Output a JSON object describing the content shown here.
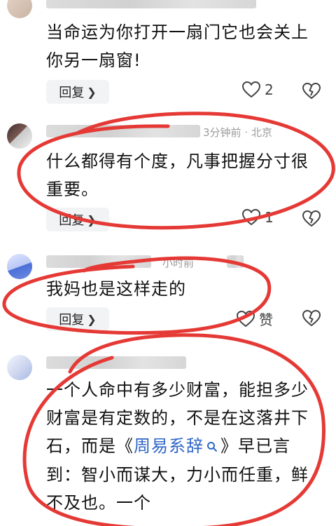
{
  "comments": [
    {
      "text": "当命运为你打开一扇门它也会关上你另一扇窗!",
      "reply_label": "回复",
      "like_count": "2"
    },
    {
      "meta_time_location": "3分钟前 · 北京",
      "text": "什么都得有个度，凡事把握分寸很重要。",
      "reply_label": "回复",
      "like_count": "1"
    },
    {
      "meta_time": "小时前",
      "text": "我妈也是这样走的",
      "reply_label": "回复",
      "like_label": "赞"
    },
    {
      "text_part1": "一个人命中有多少财富，能担多少财富是有定数的，不是在这落井下石，而是《",
      "link_text": "周易系辞",
      "text_part2": "》早已言到：智小而谋大，力小而任重，鲜不及也。一个"
    }
  ],
  "colors": {
    "annotation_red": "#e53935",
    "link_blue": "#2f66c7",
    "reply_bg": "#f2f3f5"
  },
  "icons": [
    "heart-icon",
    "heart-broken-icon",
    "chevron-right-icon",
    "search-icon"
  ]
}
